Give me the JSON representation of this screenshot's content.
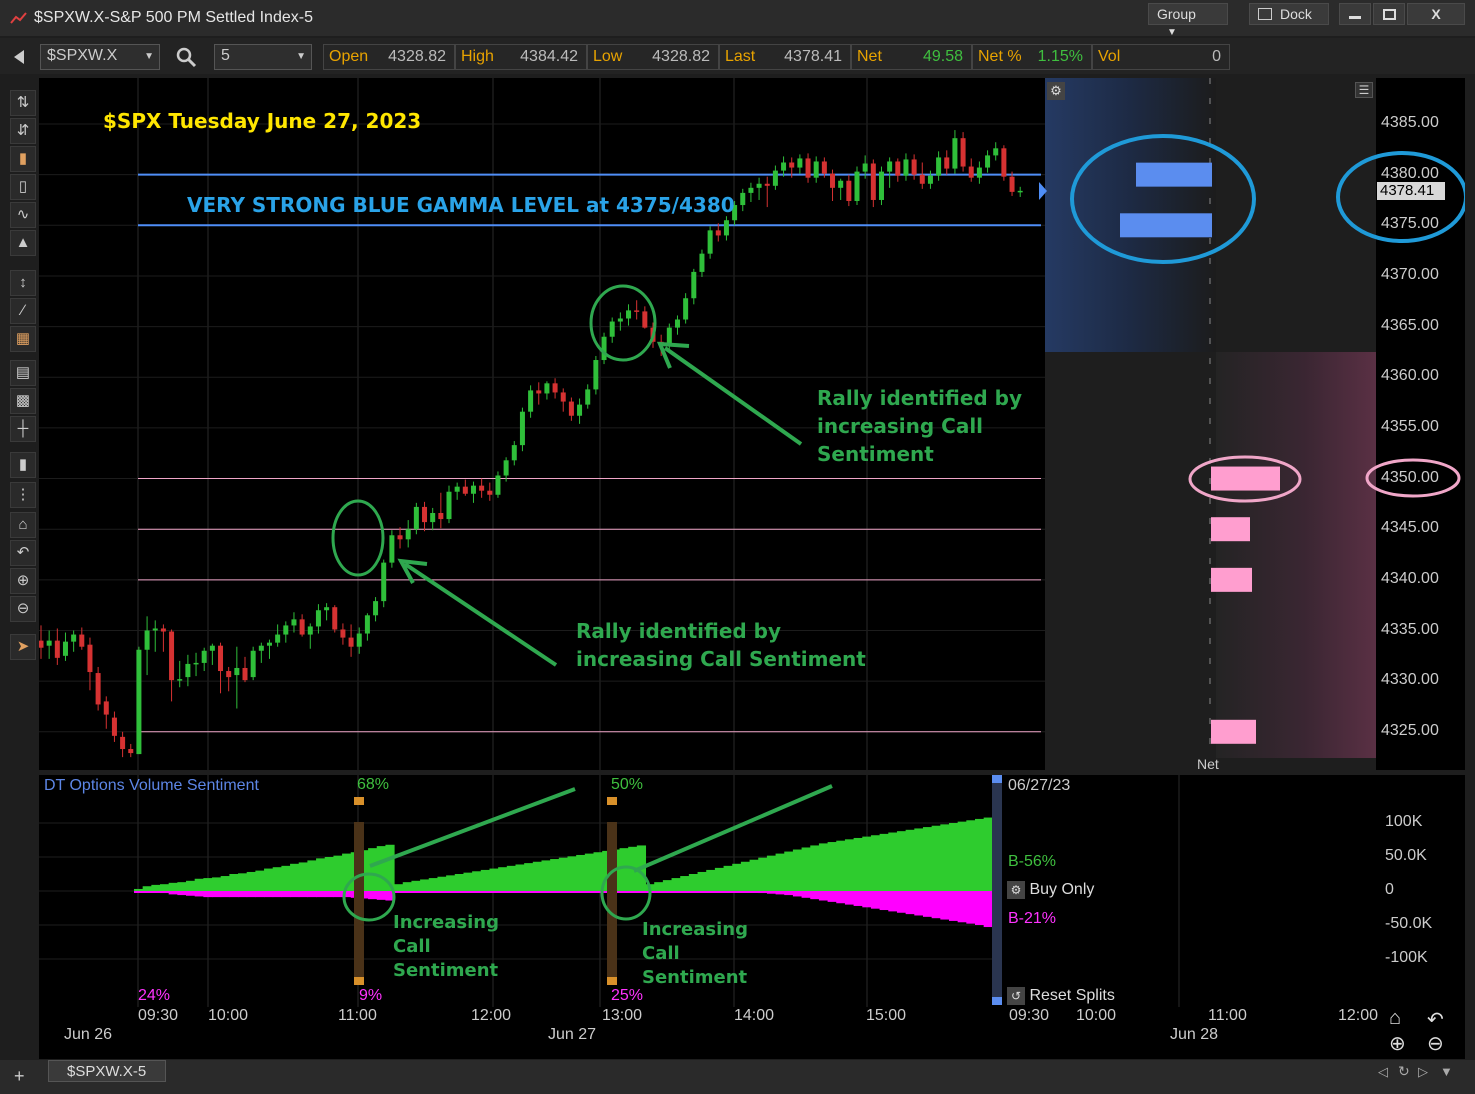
{
  "window": {
    "title": "$SPXW.X-S&P 500 PM Settled Index-5",
    "group_label": "Group",
    "dock_label": "Dock",
    "minimize_icon": "minimize-icon",
    "maximize_icon": "maximize-icon",
    "close_label": "X"
  },
  "toolbar": {
    "symbol": "$SPXW.X",
    "interval": "5",
    "quotes": [
      {
        "label": "Open",
        "value": "4328.82"
      },
      {
        "label": "High",
        "value": "4384.42"
      },
      {
        "label": "Low",
        "value": "4328.82"
      },
      {
        "label": "Last",
        "value": "4378.41"
      },
      {
        "label": "Net",
        "value": "49.58"
      },
      {
        "label": "Net %",
        "value": "1.15%"
      },
      {
        "label": "Vol",
        "value": "0"
      }
    ],
    "positive_color": "#3fbf3f"
  },
  "annotations": {
    "chart_title": "$SPX Tuesday June 27, 2023",
    "gamma_note": "VERY STRONG BLUE GAMMA LEVEL at 4375/4380",
    "rally_note_1_lines": [
      "Rally identified by",
      "increasing Call Sentiment"
    ],
    "rally_note_2_lines": [
      "Rally identified by",
      "increasing Call",
      "Sentiment"
    ],
    "call_note_lines": [
      "Increasing",
      "Call",
      "Sentiment"
    ]
  },
  "price_axis": {
    "ticks": [
      "4385.00",
      "4380.00",
      "4375.00",
      "4370.00",
      "4365.00",
      "4360.00",
      "4355.00",
      "4350.00",
      "4345.00",
      "4340.00",
      "4335.00",
      "4330.00",
      "4325.00"
    ],
    "last_price": "4378.41"
  },
  "gex_panel": {
    "net_label": "Net",
    "blue_levels": [
      4375,
      4380
    ],
    "pink_levels": [
      4325,
      4340,
      4345,
      4350
    ]
  },
  "lower_panel": {
    "title": "DT Options Volume Sentiment",
    "date": "06/27/23",
    "buy_pct": "B-56%",
    "buy_only_label": "Buy Only",
    "sell_pct": "B-21%",
    "reset_label": "Reset Splits",
    "ticks": [
      "100K",
      "50.0K",
      "0",
      "-50.0K",
      "-100K"
    ],
    "top_pcts": [
      "68%",
      "50%"
    ],
    "bottom_pcts": [
      "24%",
      "9%",
      "25%"
    ]
  },
  "time_axis": {
    "times": [
      "09:30",
      "10:00",
      "11:00",
      "12:00",
      "13:00",
      "14:00",
      "15:00",
      "09:30",
      "10:00",
      "11:00",
      "12:00"
    ],
    "dates": [
      "Jun 26",
      "Jun 27",
      "Jun 28"
    ]
  },
  "bottom_tab": "$SPXW.X-5",
  "colors": {
    "up": "#2fbf3a",
    "down": "#d63232",
    "blue_line": "#4f8ef7",
    "pink_line": "#f0a6c8",
    "annotation_green": "#2fa84f",
    "title_yellow": "#ffe600",
    "gamma_blue": "#2aa3e8",
    "sentiment_green": "#2ecc2e",
    "sentiment_magenta": "#ff00ff"
  },
  "chart_data": {
    "type": "candlestick",
    "title": "$SPX Tuesday June 27, 2023",
    "interval": "5",
    "ylim": [
      4322,
      4389
    ],
    "horizontal_levels": {
      "blue": [
        4375,
        4380
      ],
      "pink": [
        4325,
        4340,
        4345,
        4350
      ]
    },
    "candles": [
      {
        "o": 4334.0,
        "h": 4335.5,
        "l": 4332.2,
        "c": 4333.3
      },
      {
        "o": 4333.5,
        "h": 4335.0,
        "l": 4332.2,
        "c": 4334.0
      },
      {
        "o": 4334.0,
        "h": 4335.2,
        "l": 4331.6,
        "c": 4332.3
      },
      {
        "o": 4332.5,
        "h": 4334.8,
        "l": 4332.0,
        "c": 4333.9
      },
      {
        "o": 4333.9,
        "h": 4335.0,
        "l": 4332.9,
        "c": 4334.6
      },
      {
        "o": 4334.6,
        "h": 4335.3,
        "l": 4333.1,
        "c": 4333.4
      },
      {
        "o": 4333.6,
        "h": 4334.3,
        "l": 4329.1,
        "c": 4330.9
      },
      {
        "o": 4330.8,
        "h": 4331.4,
        "l": 4327.1,
        "c": 4327.7
      },
      {
        "o": 4328.0,
        "h": 4328.5,
        "l": 4325.3,
        "c": 4326.7
      },
      {
        "o": 4326.4,
        "h": 4327.0,
        "l": 4324.0,
        "c": 4324.6
      },
      {
        "o": 4324.5,
        "h": 4325.0,
        "l": 4322.5,
        "c": 4323.3
      },
      {
        "o": 4323.3,
        "h": 4323.8,
        "l": 4322.5,
        "c": 4322.9
      },
      {
        "o": 4322.8,
        "h": 4333.4,
        "l": 4322.8,
        "c": 4333.1
      },
      {
        "o": 4333.1,
        "h": 4336.4,
        "l": 4330.6,
        "c": 4335.0
      },
      {
        "o": 4335.0,
        "h": 4336.0,
        "l": 4332.9,
        "c": 4335.2
      },
      {
        "o": 4335.2,
        "h": 4335.6,
        "l": 4332.9,
        "c": 4334.9
      },
      {
        "o": 4334.9,
        "h": 4335.1,
        "l": 4328.0,
        "c": 4330.1
      },
      {
        "o": 4330.1,
        "h": 4332.0,
        "l": 4329.4,
        "c": 4330.2
      },
      {
        "o": 4330.4,
        "h": 4332.6,
        "l": 4329.5,
        "c": 4331.7
      },
      {
        "o": 4331.8,
        "h": 4332.8,
        "l": 4330.5,
        "c": 4331.8
      },
      {
        "o": 4331.8,
        "h": 4333.3,
        "l": 4331.0,
        "c": 4333.0
      },
      {
        "o": 4333.0,
        "h": 4333.7,
        "l": 4331.6,
        "c": 4333.5
      },
      {
        "o": 4333.5,
        "h": 4333.8,
        "l": 4328.8,
        "c": 4331.0
      },
      {
        "o": 4331.0,
        "h": 4331.4,
        "l": 4329.0,
        "c": 4330.4
      },
      {
        "o": 4330.6,
        "h": 4333.4,
        "l": 4327.3,
        "c": 4331.3
      },
      {
        "o": 4331.3,
        "h": 4332.4,
        "l": 4329.9,
        "c": 4330.1
      },
      {
        "o": 4330.4,
        "h": 4333.4,
        "l": 4330.1,
        "c": 4333.0
      },
      {
        "o": 4333.0,
        "h": 4333.8,
        "l": 4331.8,
        "c": 4333.5
      },
      {
        "o": 4333.5,
        "h": 4334.1,
        "l": 4332.2,
        "c": 4333.8
      },
      {
        "o": 4333.8,
        "h": 4335.6,
        "l": 4333.4,
        "c": 4334.6
      },
      {
        "o": 4334.6,
        "h": 4335.9,
        "l": 4333.8,
        "c": 4335.5
      },
      {
        "o": 4335.5,
        "h": 4336.8,
        "l": 4334.8,
        "c": 4336.1
      },
      {
        "o": 4336.1,
        "h": 4336.6,
        "l": 4334.4,
        "c": 4334.6
      },
      {
        "o": 4334.6,
        "h": 4335.7,
        "l": 4333.2,
        "c": 4335.4
      },
      {
        "o": 4335.4,
        "h": 4337.6,
        "l": 4334.7,
        "c": 4337.0
      },
      {
        "o": 4337.0,
        "h": 4337.7,
        "l": 4336.0,
        "c": 4337.3
      },
      {
        "o": 4337.3,
        "h": 4337.5,
        "l": 4334.8,
        "c": 4335.1
      },
      {
        "o": 4335.1,
        "h": 4335.7,
        "l": 4333.6,
        "c": 4334.3
      },
      {
        "o": 4334.3,
        "h": 4335.6,
        "l": 4332.4,
        "c": 4333.4
      },
      {
        "o": 4333.4,
        "h": 4335.3,
        "l": 4332.7,
        "c": 4334.7
      },
      {
        "o": 4334.7,
        "h": 4336.7,
        "l": 4334.0,
        "c": 4336.5
      },
      {
        "o": 4336.5,
        "h": 4338.3,
        "l": 4335.9,
        "c": 4337.9
      },
      {
        "o": 4337.9,
        "h": 4342.0,
        "l": 4337.3,
        "c": 4341.7
      },
      {
        "o": 4341.7,
        "h": 4344.9,
        "l": 4341.2,
        "c": 4344.4
      },
      {
        "o": 4344.4,
        "h": 4345.2,
        "l": 4343.1,
        "c": 4344.0
      },
      {
        "o": 4344.0,
        "h": 4345.9,
        "l": 4343.2,
        "c": 4345.0
      },
      {
        "o": 4345.0,
        "h": 4347.6,
        "l": 4344.5,
        "c": 4347.2
      },
      {
        "o": 4347.2,
        "h": 4347.7,
        "l": 4344.8,
        "c": 4345.7
      },
      {
        "o": 4345.7,
        "h": 4347.1,
        "l": 4344.9,
        "c": 4346.6
      },
      {
        "o": 4346.6,
        "h": 4348.6,
        "l": 4345.1,
        "c": 4346.0
      },
      {
        "o": 4346.0,
        "h": 4349.3,
        "l": 4345.6,
        "c": 4348.7
      },
      {
        "o": 4348.7,
        "h": 4349.6,
        "l": 4347.9,
        "c": 4349.2
      },
      {
        "o": 4349.2,
        "h": 4349.9,
        "l": 4348.3,
        "c": 4348.5
      },
      {
        "o": 4348.5,
        "h": 4349.7,
        "l": 4347.6,
        "c": 4349.3
      },
      {
        "o": 4349.3,
        "h": 4350.0,
        "l": 4348.1,
        "c": 4348.8
      },
      {
        "o": 4348.8,
        "h": 4349.6,
        "l": 4347.8,
        "c": 4348.4
      },
      {
        "o": 4348.4,
        "h": 4350.7,
        "l": 4348.1,
        "c": 4350.3
      },
      {
        "o": 4350.3,
        "h": 4352.1,
        "l": 4349.7,
        "c": 4351.8
      },
      {
        "o": 4351.8,
        "h": 4353.7,
        "l": 4351.3,
        "c": 4353.3
      },
      {
        "o": 4353.3,
        "h": 4357.0,
        "l": 4352.7,
        "c": 4356.6
      },
      {
        "o": 4356.6,
        "h": 4359.2,
        "l": 4356.0,
        "c": 4358.7
      },
      {
        "o": 4358.7,
        "h": 4359.5,
        "l": 4357.3,
        "c": 4358.4
      },
      {
        "o": 4358.4,
        "h": 4359.6,
        "l": 4357.8,
        "c": 4359.4
      },
      {
        "o": 4359.4,
        "h": 4359.9,
        "l": 4357.9,
        "c": 4358.5
      },
      {
        "o": 4358.5,
        "h": 4358.9,
        "l": 4356.6,
        "c": 4357.6
      },
      {
        "o": 4357.6,
        "h": 4358.0,
        "l": 4355.7,
        "c": 4356.2
      },
      {
        "o": 4356.2,
        "h": 4357.9,
        "l": 4355.4,
        "c": 4357.3
      },
      {
        "o": 4357.3,
        "h": 4359.3,
        "l": 4356.9,
        "c": 4358.8
      },
      {
        "o": 4358.8,
        "h": 4362.1,
        "l": 4358.3,
        "c": 4361.7
      },
      {
        "o": 4361.7,
        "h": 4364.4,
        "l": 4361.3,
        "c": 4364.0
      },
      {
        "o": 4364.0,
        "h": 4365.9,
        "l": 4363.4,
        "c": 4365.5
      },
      {
        "o": 4365.5,
        "h": 4366.4,
        "l": 4364.6,
        "c": 4365.8
      },
      {
        "o": 4365.8,
        "h": 4367.2,
        "l": 4365.1,
        "c": 4366.6
      },
      {
        "o": 4366.6,
        "h": 4367.6,
        "l": 4365.7,
        "c": 4366.5
      },
      {
        "o": 4366.5,
        "h": 4367.0,
        "l": 4364.8,
        "c": 4364.9
      },
      {
        "o": 4364.9,
        "h": 4365.4,
        "l": 4362.9,
        "c": 4363.5
      },
      {
        "o": 4363.5,
        "h": 4364.2,
        "l": 4362.1,
        "c": 4363.2
      },
      {
        "o": 4363.2,
        "h": 4365.3,
        "l": 4362.8,
        "c": 4364.9
      },
      {
        "o": 4364.9,
        "h": 4366.1,
        "l": 4364.2,
        "c": 4365.7
      },
      {
        "o": 4365.7,
        "h": 4368.3,
        "l": 4365.3,
        "c": 4367.8
      },
      {
        "o": 4367.8,
        "h": 4370.7,
        "l": 4367.2,
        "c": 4370.4
      },
      {
        "o": 4370.4,
        "h": 4372.6,
        "l": 4369.9,
        "c": 4372.2
      },
      {
        "o": 4372.2,
        "h": 4374.9,
        "l": 4371.7,
        "c": 4374.5
      },
      {
        "o": 4374.5,
        "h": 4375.2,
        "l": 4373.4,
        "c": 4374.0
      },
      {
        "o": 4374.0,
        "h": 4375.9,
        "l": 4373.5,
        "c": 4375.5
      },
      {
        "o": 4375.5,
        "h": 4377.4,
        "l": 4375.0,
        "c": 4377.0
      },
      {
        "o": 4377.0,
        "h": 4378.6,
        "l": 4376.4,
        "c": 4378.2
      },
      {
        "o": 4378.2,
        "h": 4379.2,
        "l": 4377.3,
        "c": 4378.7
      },
      {
        "o": 4378.7,
        "h": 4379.7,
        "l": 4377.5,
        "c": 4379.1
      },
      {
        "o": 4379.1,
        "h": 4379.8,
        "l": 4376.8,
        "c": 4378.9
      },
      {
        "o": 4378.9,
        "h": 4380.9,
        "l": 4378.5,
        "c": 4380.4
      },
      {
        "o": 4380.4,
        "h": 4381.8,
        "l": 4379.8,
        "c": 4381.2
      },
      {
        "o": 4381.2,
        "h": 4381.7,
        "l": 4379.7,
        "c": 4380.7
      },
      {
        "o": 4380.7,
        "h": 4382.0,
        "l": 4380.1,
        "c": 4381.6
      },
      {
        "o": 4381.6,
        "h": 4382.1,
        "l": 4379.2,
        "c": 4379.7
      },
      {
        "o": 4379.7,
        "h": 4381.8,
        "l": 4379.2,
        "c": 4381.3
      },
      {
        "o": 4381.3,
        "h": 4381.7,
        "l": 4379.7,
        "c": 4380.1
      },
      {
        "o": 4380.1,
        "h": 4380.5,
        "l": 4377.4,
        "c": 4378.7
      },
      {
        "o": 4378.7,
        "h": 4379.6,
        "l": 4377.5,
        "c": 4379.4
      },
      {
        "o": 4379.4,
        "h": 4380.0,
        "l": 4376.9,
        "c": 4377.4
      },
      {
        "o": 4377.4,
        "h": 4380.8,
        "l": 4377.0,
        "c": 4380.3
      },
      {
        "o": 4380.3,
        "h": 4381.9,
        "l": 4379.6,
        "c": 4381.1
      },
      {
        "o": 4381.1,
        "h": 4381.5,
        "l": 4376.8,
        "c": 4377.5
      },
      {
        "o": 4377.5,
        "h": 4380.8,
        "l": 4377.0,
        "c": 4380.3
      },
      {
        "o": 4380.3,
        "h": 4381.7,
        "l": 4378.7,
        "c": 4381.3
      },
      {
        "o": 4381.3,
        "h": 4381.6,
        "l": 4379.3,
        "c": 4379.9
      },
      {
        "o": 4379.9,
        "h": 4382.1,
        "l": 4379.4,
        "c": 4381.5
      },
      {
        "o": 4381.5,
        "h": 4382.0,
        "l": 4379.5,
        "c": 4380.0
      },
      {
        "o": 4380.0,
        "h": 4381.2,
        "l": 4378.6,
        "c": 4379.1
      },
      {
        "o": 4379.1,
        "h": 4380.4,
        "l": 4378.6,
        "c": 4379.9
      },
      {
        "o": 4379.9,
        "h": 4382.3,
        "l": 4379.4,
        "c": 4381.7
      },
      {
        "o": 4381.7,
        "h": 4382.4,
        "l": 4380.0,
        "c": 4380.6
      },
      {
        "o": 4380.6,
        "h": 4384.4,
        "l": 4380.1,
        "c": 4383.6
      },
      {
        "o": 4383.6,
        "h": 4384.2,
        "l": 4380.3,
        "c": 4380.8
      },
      {
        "o": 4380.8,
        "h": 4381.6,
        "l": 4379.3,
        "c": 4379.7
      },
      {
        "o": 4379.7,
        "h": 4381.3,
        "l": 4379.1,
        "c": 4380.7
      },
      {
        "o": 4380.7,
        "h": 4382.4,
        "l": 4380.2,
        "c": 4381.9
      },
      {
        "o": 4381.9,
        "h": 4383.2,
        "l": 4381.4,
        "c": 4382.6
      },
      {
        "o": 4382.6,
        "h": 4382.9,
        "l": 4379.4,
        "c": 4379.8
      },
      {
        "o": 4379.8,
        "h": 4380.3,
        "l": 4377.9,
        "c": 4378.3
      },
      {
        "o": 4378.3,
        "h": 4378.8,
        "l": 4377.8,
        "c": 4378.4
      }
    ],
    "sentiment": {
      "buy": [
        3,
        7,
        9,
        10,
        12,
        13,
        15,
        18,
        19,
        20,
        22,
        25,
        26,
        28,
        30,
        33,
        35,
        37,
        40,
        42,
        45,
        48,
        50,
        52,
        55,
        57,
        60,
        63,
        66,
        68,
        10,
        13,
        15,
        17,
        19,
        21,
        23,
        25,
        27,
        29,
        31,
        33,
        35,
        37,
        39,
        41,
        43,
        45,
        47,
        49,
        51,
        53,
        55,
        57,
        59,
        61,
        63,
        65,
        67,
        10,
        13,
        16,
        19,
        22,
        25,
        28,
        31,
        34,
        37,
        40,
        43,
        46,
        49,
        52,
        55,
        58,
        61,
        64,
        67,
        70,
        72,
        74,
        76,
        78,
        80,
        82,
        84,
        86,
        88,
        90,
        92,
        94,
        96,
        98,
        100,
        102,
        104,
        106,
        108,
        110
      ],
      "sell": [
        0,
        -1,
        -2,
        -3,
        -5,
        -6,
        -7,
        -8,
        -9,
        -9,
        -9,
        -9,
        -9,
        -9,
        -9,
        -9,
        -9,
        -9,
        -9,
        -9,
        -9,
        -9,
        -9,
        -9,
        -9,
        -10,
        -11,
        -12,
        -13,
        -14,
        -1,
        -1,
        -1,
        -1,
        -1,
        -1,
        -1,
        -1,
        -1,
        -1,
        -1,
        -1,
        -1,
        -1,
        -1,
        -1,
        -1,
        -1,
        -1,
        -1,
        -1,
        -1,
        -1,
        -1,
        -1,
        -1,
        -1,
        -1,
        -1,
        -1,
        -1,
        -1,
        -1,
        -1,
        -1,
        -1,
        -1,
        -1,
        -1,
        -1,
        -1,
        -2,
        -3,
        -4,
        -5,
        -6,
        -8,
        -10,
        -12,
        -14,
        -16,
        -18,
        -20,
        -22,
        -24,
        -26,
        -28,
        -30,
        -32,
        -34,
        -36,
        -38,
        -40,
        -42,
        -44,
        -46,
        -48,
        -50,
        -53,
        -56,
        -60,
        -64,
        -68,
        -72
      ]
    }
  }
}
